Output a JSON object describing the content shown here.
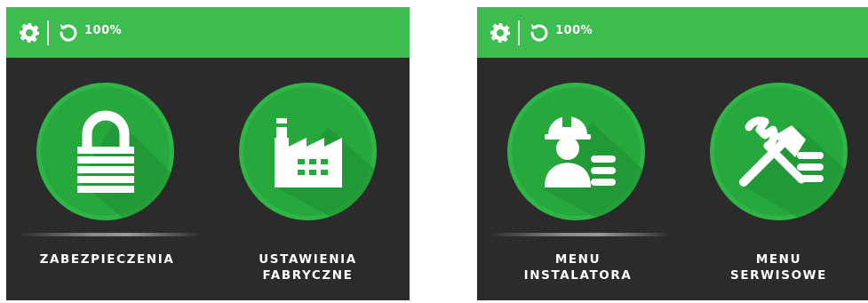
{
  "screens": [
    {
      "battery": "100%",
      "tiles": [
        {
          "label_line1": "ZABEZPIECZENIA",
          "label_line2": "",
          "icon": "lock-icon"
        },
        {
          "label_line1": "USTAWIENIA",
          "label_line2": "FABRYCZNE",
          "icon": "factory-icon"
        }
      ]
    },
    {
      "battery": "100%",
      "tiles": [
        {
          "label_line1": "MENU",
          "label_line2": "INSTALATORA",
          "icon": "installer-icon"
        },
        {
          "label_line1": "MENU",
          "label_line2": "SERWISOWE",
          "icon": "service-tools-icon"
        }
      ]
    }
  ],
  "colors": {
    "accent": "#3dbd4f",
    "background": "#2b2b2b",
    "tile": "#27a83d"
  }
}
